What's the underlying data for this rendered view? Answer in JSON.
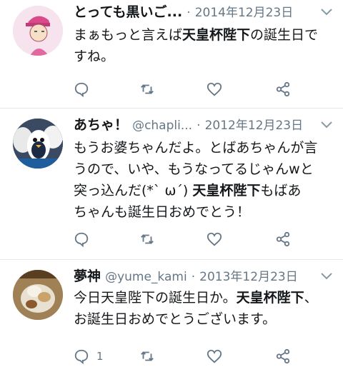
{
  "tweets": [
    {
      "name": "とっても黒いご...",
      "handle": "",
      "dot": "·",
      "date": "2014年12月23日",
      "text_lines": [
        [
          {
            "t": "まぁもっと言えば",
            "b": false
          },
          {
            "t": "天皇杯陛下",
            "b": true
          },
          {
            "t": "の誕生日で",
            "b": false
          }
        ],
        [
          {
            "t": "すね。",
            "b": false
          }
        ]
      ],
      "reply_count": ""
    },
    {
      "name": "あちゃ！",
      "handle": "@chapli...",
      "dot": "·",
      "date": "2012年12月23日",
      "text_lines": [
        [
          {
            "t": "もうお婆ちゃんだよ。とばあちゃんが言",
            "b": false
          }
        ],
        [
          {
            "t": "うので、いや、もうなってるじゃんwと",
            "b": false
          }
        ],
        [
          {
            "t": "突っ込んだ(*ˋ ω´) ",
            "b": false
          },
          {
            "t": "天皇杯陛下",
            "b": true
          },
          {
            "t": "もばあ",
            "b": false
          }
        ],
        [
          {
            "t": "ちゃんも誕生日おめでとう！",
            "b": false
          }
        ]
      ],
      "reply_count": ""
    },
    {
      "name": "夢神",
      "handle": "@yume_kami",
      "dot": "·",
      "date": "2013年12月23日",
      "text_lines": [
        [
          {
            "t": "今日天皇陛下の誕生日か。",
            "b": false
          },
          {
            "t": "天皇杯陛下",
            "b": true
          },
          {
            "t": "、",
            "b": false
          }
        ],
        [
          {
            "t": "お誕生日おめでとうございます。",
            "b": false
          }
        ]
      ],
      "reply_count": "1"
    }
  ],
  "icons": {
    "reply": "reply-icon",
    "retweet": "retweet-icon",
    "like": "heart-icon",
    "share": "share-icon",
    "more": "chevron-down-icon"
  },
  "colors": {
    "text": "#14171a",
    "muted": "#657786",
    "divider": "#e1e8ed"
  }
}
